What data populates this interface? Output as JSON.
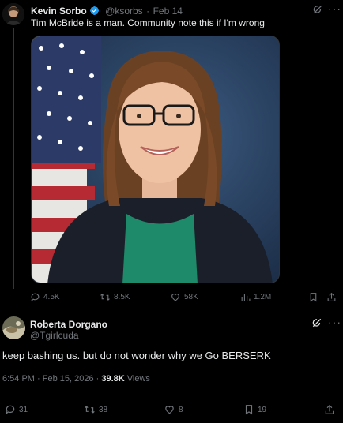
{
  "tweet": {
    "author_name": "Kevin Sorbo",
    "handle": "@ksorbs",
    "separator": "·",
    "date": "Feb 14",
    "text": "Tim McBride is a man. Community note this if I'm wrong",
    "metrics": {
      "replies": "4.5K",
      "reposts": "8.5K",
      "likes": "58K",
      "views": "1.2M"
    }
  },
  "reply": {
    "author_name": "Roberta Dorgano",
    "handle": "@Tgirlcuda",
    "text": "keep bashing us. but do not wonder why we Go BERSERK",
    "time": "6:54 PM · Feb 15, 2026 · ",
    "views_count": "39.8K",
    "views_label": " Views",
    "metrics": {
      "replies": "31",
      "reposts": "38",
      "likes": "8",
      "bookmarks": "19"
    }
  },
  "colors": {
    "background": "#000000",
    "text": "#e7e9ea",
    "muted": "#71767b",
    "verified": "#1d9bf0",
    "divider": "#2f3336"
  }
}
